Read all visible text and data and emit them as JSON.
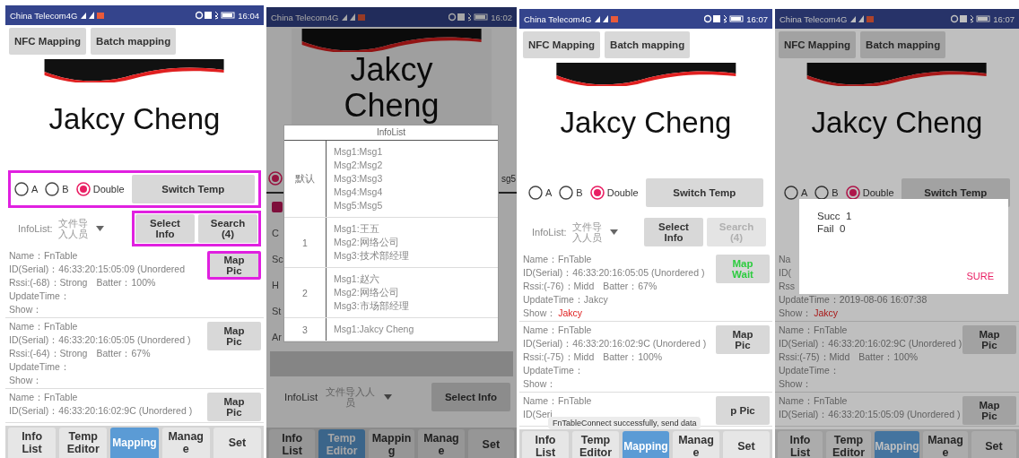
{
  "phones": [
    {
      "kind": "mapping",
      "status_bar": {
        "carrier": "China Telecom4G",
        "time": "16:04"
      },
      "top_buttons": [
        "NFC Mapping",
        "Batch mapping"
      ],
      "logo": {
        "text": "Jakcy Cheng"
      },
      "mode_row": {
        "highlighted": true,
        "radios": [
          {
            "label": "A",
            "selected": false
          },
          {
            "label": "B",
            "selected": false
          },
          {
            "label": "Double",
            "selected": true
          }
        ],
        "button": "Switch Temp"
      },
      "info_row": {
        "label": "InfoList:",
        "dropdown": "文件导入人员",
        "highlighted": true,
        "buttons": [
          {
            "label": "Select Info",
            "disabled": false
          },
          {
            "label": "Search (4)",
            "disabled": false
          }
        ]
      },
      "records": [
        {
          "lines": [
            [
              "Name：FnTable"
            ],
            [
              "ID(Serial)：46:33:20:15:05:09 (Unordered"
            ],
            [
              "Rssi:(-68)：Strong",
              "Batter：100%"
            ],
            [
              "UpdateTime："
            ],
            [
              "Show："
            ]
          ],
          "button": {
            "label": "Map Pic",
            "kind": "pic",
            "highlighted": true
          }
        },
        {
          "lines": [
            [
              "Name：FnTable"
            ],
            [
              "ID(Serial)：46:33:20:16:05:05 (Unordered )"
            ],
            [
              "Rssi:(-64)：Strong",
              "Batter：67%"
            ],
            [
              "UpdateTime："
            ],
            [
              "Show："
            ]
          ],
          "button": {
            "label": "Map Pic",
            "kind": "pic",
            "highlighted": false
          }
        },
        {
          "lines": [
            [
              "Name：FnTable"
            ],
            [
              "ID(Serial)：46:33:20:16:02:9C (Unordered )"
            ]
          ],
          "button": {
            "label": "Map Pic",
            "kind": "pic",
            "highlighted": false
          }
        }
      ],
      "nav": [
        {
          "label": "Info List",
          "selected": false
        },
        {
          "label": "Temp Editor",
          "selected": false
        },
        {
          "label": "Mapping",
          "selected": true
        },
        {
          "label": "Manage",
          "selected": false
        },
        {
          "label": "Set",
          "selected": false
        }
      ]
    },
    {
      "kind": "editor",
      "dimmed": true,
      "status_bar": {
        "carrier": "China Telecom4G",
        "time": "16:02"
      },
      "logo": {
        "text": "Jakcy Cheng"
      },
      "form": {
        "right_text": "sg5",
        "labels": [
          "C",
          "Sc",
          "H",
          "St",
          "Ar"
        ]
      },
      "info_row": {
        "label": "InfoList",
        "dropdown": "文件导入人员",
        "buttons": [
          {
            "label": "Select Info",
            "disabled": false
          }
        ]
      },
      "nav": [
        {
          "label": "Info List",
          "selected": false
        },
        {
          "label": "Temp Editor",
          "selected": true
        },
        {
          "label": "Mapping",
          "selected": false
        },
        {
          "label": "Manage",
          "selected": false
        },
        {
          "label": "Set",
          "selected": false
        }
      ],
      "dialog": {
        "kind": "table",
        "title": "InfoList",
        "rows": [
          {
            "key": "默认",
            "lines": [
              "Msg1:Msg1",
              "Msg2:Msg2",
              "Msg3:Msg3",
              "Msg4:Msg4",
              "Msg5:Msg5"
            ]
          },
          {
            "key": "1",
            "lines": [
              "Msg1:王五",
              "Msg2:网络公司",
              "Msg3:技术部经理"
            ]
          },
          {
            "key": "2",
            "lines": [
              "Msg1:赵六",
              "Msg2:网络公司",
              "Msg3:市场部经理"
            ]
          },
          {
            "key": "3",
            "lines": [
              "Msg1:Jakcy Cheng"
            ]
          }
        ]
      }
    },
    {
      "kind": "mapping",
      "status_bar": {
        "carrier": "China Telecom4G",
        "time": "16:07"
      },
      "top_buttons": [
        "NFC Mapping",
        "Batch mapping"
      ],
      "logo": {
        "text": "Jakcy Cheng"
      },
      "mode_row": {
        "radios": [
          {
            "label": "A",
            "selected": false
          },
          {
            "label": "B",
            "selected": false
          },
          {
            "label": "Double",
            "selected": true
          }
        ],
        "button": "Switch Temp"
      },
      "info_row": {
        "label": "InfoList:",
        "dropdown": "文件导入人员",
        "buttons": [
          {
            "label": "Select Info",
            "disabled": false
          },
          {
            "label": "Search (4)",
            "disabled": true
          }
        ]
      },
      "records": [
        {
          "lines": [
            [
              "Name：FnTable"
            ],
            [
              "ID(Serial)：46:33:20:16:05:05 (Unordered )"
            ],
            [
              "Rssi:(-76)：Midd",
              "Batter：67%"
            ],
            [
              "UpdateTime：Jakcy"
            ],
            [
              "Show："
            ]
          ],
          "show_value": "Jakcy",
          "button": {
            "label": "Map Wait",
            "kind": "wait",
            "highlighted": false
          }
        },
        {
          "lines": [
            [
              "Name：FnTable"
            ],
            [
              "ID(Serial)：46:33:20:16:02:9C (Unordered )"
            ],
            [
              "Rssi:(-75)：Midd",
              "Batter：100%"
            ],
            [
              "UpdateTime："
            ],
            [
              "Show："
            ]
          ],
          "button": {
            "label": "Map Pic",
            "kind": "pic",
            "highlighted": false
          }
        },
        {
          "lines": [
            [
              "Name：FnTable"
            ],
            [
              "ID(Seri"
            ]
          ],
          "button": {
            "label": "p Pic",
            "kind": "pic",
            "highlighted": false
          }
        }
      ],
      "toast": "FnTableConnect successfully, send data",
      "nav": [
        {
          "label": "Info List",
          "selected": false
        },
        {
          "label": "Temp Editor",
          "selected": false
        },
        {
          "label": "Mapping",
          "selected": true
        },
        {
          "label": "Manage",
          "selected": false
        },
        {
          "label": "Set",
          "selected": false
        }
      ]
    },
    {
      "kind": "mapping",
      "dimmed": true,
      "status_bar": {
        "carrier": "China Telecom4G",
        "time": "16:07"
      },
      "top_buttons": [
        "NFC Mapping",
        "Batch mapping"
      ],
      "logo": {
        "text": "Jakcy Cheng"
      },
      "mode_row": {
        "radios": [
          {
            "label": "A",
            "selected": false
          },
          {
            "label": "B",
            "selected": false
          },
          {
            "label": "Double",
            "selected": true
          }
        ],
        "button": "Switch Temp"
      },
      "records": [
        {
          "lines": [
            [
              "Na"
            ],
            [
              "ID("
            ],
            [
              "Rss"
            ],
            [
              "UpdateTime：2019-08-06 16:07:38"
            ],
            [
              "Show："
            ]
          ],
          "show_value": "Jakcy"
        },
        {
          "lines": [
            [
              "Name：FnTable"
            ],
            [
              "ID(Serial)：46:33:20:16:02:9C (Unordered )"
            ],
            [
              "Rssi:(-75)：Midd",
              "Batter：100%"
            ],
            [
              "UpdateTime："
            ],
            [
              "Show："
            ]
          ],
          "button": {
            "label": "Map Pic",
            "kind": "pic",
            "highlighted": false
          }
        },
        {
          "lines": [
            [
              "Name：FnTable"
            ],
            [
              "ID(Serial)：46:33:20:15:05:09 (Unordered )"
            ]
          ],
          "button": {
            "label": "Map Pic",
            "kind": "pic",
            "highlighted": false
          }
        }
      ],
      "nav": [
        {
          "label": "Info List",
          "selected": false
        },
        {
          "label": "Temp Editor",
          "selected": false
        },
        {
          "label": "Mapping",
          "selected": true
        },
        {
          "label": "Manage",
          "selected": false
        },
        {
          "label": "Set",
          "selected": false
        }
      ],
      "dialog": {
        "kind": "result",
        "lines": [
          "Succ  1",
          "Fail  0"
        ],
        "button": "SURE"
      }
    }
  ]
}
